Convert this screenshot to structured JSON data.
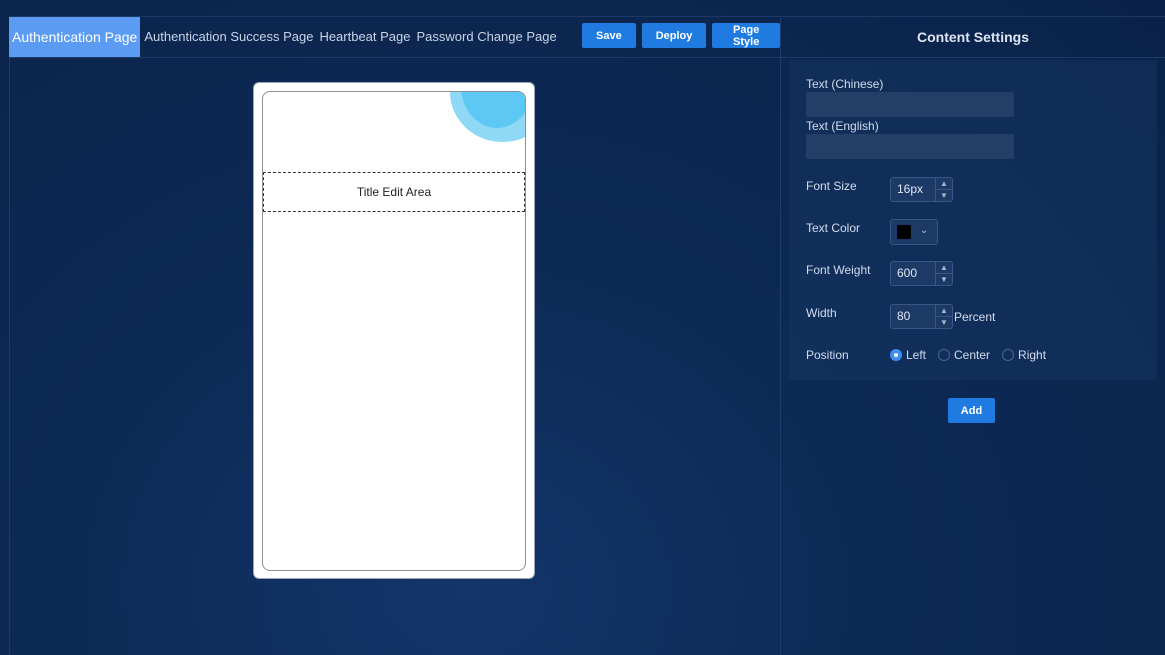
{
  "tabs": [
    {
      "label": "Authentication Page",
      "active": true
    },
    {
      "label": "Authentication Success Page",
      "active": false
    },
    {
      "label": "Heartbeat Page",
      "active": false
    },
    {
      "label": "Password Change Page",
      "active": false
    }
  ],
  "toolbar": {
    "save_label": "Save",
    "deploy_label": "Deploy",
    "page_style_label": "Page Style"
  },
  "preview": {
    "title_area_label": "Title Edit Area"
  },
  "settings": {
    "header": "Content Settings",
    "text_chinese_label": "Text (Chinese)",
    "text_chinese_value": "",
    "text_english_label": "Text (English)",
    "text_english_value": "",
    "font_size_label": "Font Size",
    "font_size_value": "16px",
    "text_color_label": "Text Color",
    "text_color_value": "#000000",
    "font_weight_label": "Font Weight",
    "font_weight_value": "600",
    "width_label": "Width",
    "width_value": "80",
    "width_unit": "Percent",
    "position_label": "Position",
    "position_options": [
      {
        "label": "Left",
        "selected": true
      },
      {
        "label": "Center",
        "selected": false
      },
      {
        "label": "Right",
        "selected": false
      }
    ],
    "add_label": "Add"
  },
  "colors": {
    "accent": "#1f7be0",
    "active_tab": "#5b9cf2",
    "background": "#0d2a56",
    "bubble_light": "#8fd8f6",
    "bubble": "#5ec8f5"
  }
}
